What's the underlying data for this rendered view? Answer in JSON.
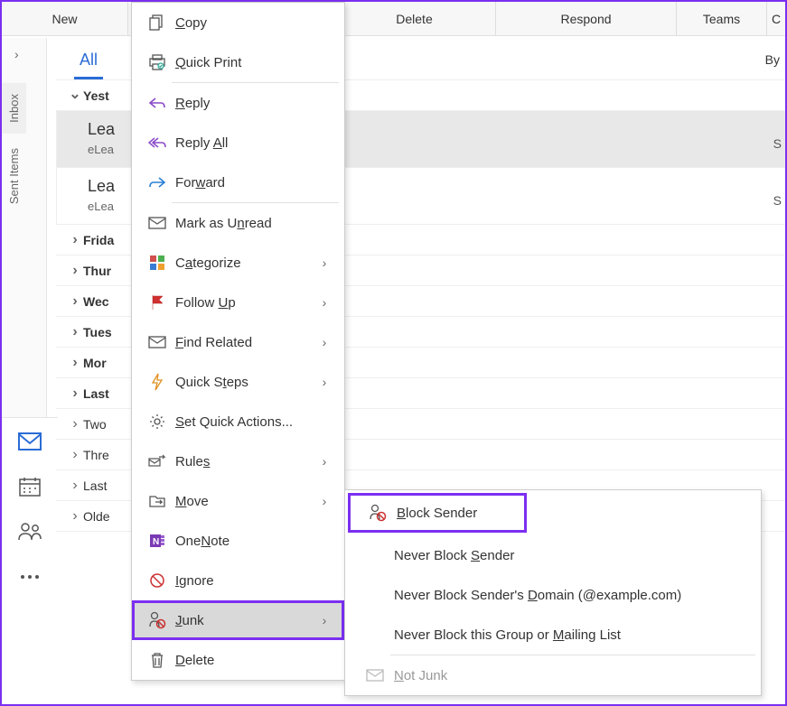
{
  "ribbon": {
    "new": "New",
    "delete": "Delete",
    "respond": "Respond",
    "teams": "Teams",
    "ac": "C"
  },
  "left_tabs": {
    "inbox": "Inbox",
    "sent": "Sent Items"
  },
  "folder": {
    "tab_all": "All",
    "by_label": "By"
  },
  "groups": {
    "yesterday": "Yest",
    "friday": "Frida",
    "thursday": "Thur",
    "wednesday": "Wec",
    "tuesday": "Tues",
    "monday": "Mor",
    "lastweek": "Last",
    "twoweeks": "Two",
    "threeweeks": "Thre",
    "lastmonth": "Last",
    "older": "Olde"
  },
  "messages": {
    "m1": {
      "subject": "Lea",
      "from": "eLea",
      "side": "S"
    },
    "m2": {
      "subject": "Lea",
      "from": "eLea",
      "side": "S"
    }
  },
  "ctx": {
    "copy": "Copy",
    "quick_print": "Quick Print",
    "reply": "Reply",
    "reply_all": "Reply All",
    "forward": "Forward",
    "mark_unread": "Mark as Unread",
    "categorize": "Categorize",
    "follow_up": "Follow Up",
    "find_related": "Find Related",
    "quick_steps": "Quick Steps",
    "set_quick_actions": "Set Quick Actions...",
    "rules": "Rules",
    "move": "Move",
    "onenote": "OneNote",
    "ignore": "Ignore",
    "junk": "Junk",
    "delete": "Delete"
  },
  "junk_menu": {
    "block_sender": "Block Sender",
    "never_block_sender": "Never Block Sender",
    "never_block_domain": "Never Block Sender's Domain (@example.com)",
    "never_block_group": "Never Block this Group or Mailing List",
    "not_junk": "Not Junk"
  }
}
